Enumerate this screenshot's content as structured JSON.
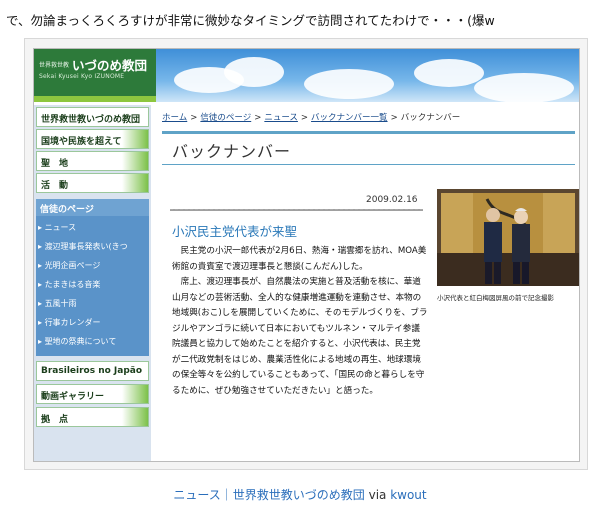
{
  "intro_text": "で、勿論まっくろくろすけが非常に微妙なタイミングで訪問されてたわけで・・・(爆w",
  "site": {
    "brand_small": "世界救世教",
    "brand_name": "いづのめ教団",
    "brand_sub": "Sekai Kyusei Kyo IZUNOME"
  },
  "sidebar": {
    "items": [
      {
        "label": "世界救世教いづのめ教団"
      },
      {
        "label": "国境や民族を超えて"
      },
      {
        "label": "聖　地"
      },
      {
        "label": "活　動"
      }
    ],
    "section_head": "信徒のページ",
    "sub_items": [
      {
        "label": "ニュース"
      },
      {
        "label": "渡辺理事長発表い(きつ"
      },
      {
        "label": "光明企画ページ"
      },
      {
        "label": "たまきはる音楽"
      },
      {
        "label": "五風十雨"
      },
      {
        "label": "行事カレンダー"
      },
      {
        "label": "聖地の祭典について"
      }
    ],
    "bottom_items": [
      {
        "label": "Brasileiros no Japão"
      },
      {
        "label": "動画ギャラリー"
      },
      {
        "label": "拠　点"
      }
    ]
  },
  "breadcrumb": {
    "items": [
      {
        "label": "ホーム"
      },
      {
        "label": "信徒のページ"
      },
      {
        "label": "ニュース"
      },
      {
        "label": "バックナンバー一覧"
      }
    ],
    "current": "バックナンバー"
  },
  "page_title": "バックナンバー",
  "article": {
    "date": "2009.02.16",
    "title": "小沢民主党代表が来聖",
    "paragraph1": "　民主党の小沢一郎代表が2月6日、熱海・瑞雲郷を訪れ、MOA美術館の貴賓室で渡辺理事長と懇談(こんだん)した。",
    "paragraph2": "　席上、渡辺理事長が、自然農法の実施と普及活動を核に、華道山月などの芸術活動、全人的な健康増進運動を連動させ、本物の地域興(おこ)しを展開していくために、そのモデルづくりを、ブラジルやアンゴラに続いて日本においてもツルネン・マルテイ参議院議員と協力して始めたことを紹介すると、小沢代表は、民主党が二代政党制をはじめ、農業活性化による地域の再生、地球環境の保全等々を公約していることもあって、「国民の命と暮らしを守るために、ぜひ勉強させていただきたい」と語った。",
    "photo_caption": "小沢代表と紅白梅図屏風の前で記念撮影"
  },
  "footer": {
    "link1": "ニュース｜世界救世教いづのめ教団",
    "via": " via ",
    "link2": "kwout"
  },
  "colors": {
    "link": "#1a4c8c",
    "title_blue": "#2a78b8",
    "brand_green": "#2d7a3a",
    "sidebar_blue": "#5a93c9"
  }
}
